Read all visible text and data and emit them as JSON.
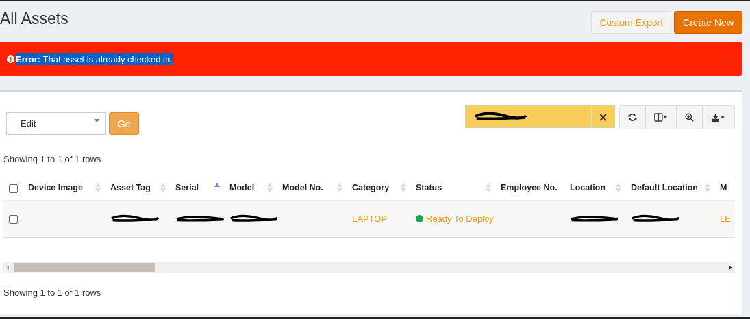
{
  "page_title": "All Assets",
  "header_buttons": [
    {
      "label": "Custom Export",
      "kind": "secondary"
    },
    {
      "label": "Create New",
      "kind": "primary"
    }
  ],
  "alert": {
    "prefix": "Error:",
    "message": "That asset is already checked in.",
    "selected": true
  },
  "bulk_action": {
    "value": "Edit",
    "button": "Go"
  },
  "search": {
    "redacted": true,
    "clear": "×"
  },
  "summary_top": "Showing 1 to 1 of 1 rows",
  "table": {
    "all_checked": false,
    "columns": [
      {
        "label": "Device Image",
        "sortable": true,
        "sorted": false
      },
      {
        "label": "Asset Tag",
        "sortable": true,
        "sorted": false
      },
      {
        "label": "Serial",
        "sortable": true,
        "sorted": true
      },
      {
        "label": "Model",
        "sortable": true,
        "sorted": false
      },
      {
        "label": "Model No.",
        "sortable": true,
        "sorted": false
      },
      {
        "label": "Category",
        "sortable": true,
        "sorted": false
      },
      {
        "label": "Status",
        "sortable": true,
        "sorted": false
      },
      {
        "label": "Employee No.",
        "sortable": false,
        "sorted": false
      },
      {
        "label": "Location",
        "sortable": true,
        "sorted": false
      },
      {
        "label": "Default Location",
        "sortable": true,
        "sorted": false
      },
      {
        "label": "M",
        "sortable": false,
        "sorted": false
      }
    ],
    "rows": [
      {
        "checked": false,
        "cells": [
          {
            "kind": "empty"
          },
          {
            "kind": "redacted"
          },
          {
            "kind": "redacted"
          },
          {
            "kind": "redacted"
          },
          {
            "kind": "empty"
          },
          {
            "kind": "link",
            "text": "LAPTOP"
          },
          {
            "kind": "status",
            "text": "Ready To Deploy",
            "color": "#18a55c"
          },
          {
            "kind": "empty"
          },
          {
            "kind": "redacted"
          },
          {
            "kind": "redacted"
          },
          {
            "kind": "link",
            "text": "LE"
          }
        ]
      }
    ]
  },
  "summary_bottom": "Showing 1 to 1 of 1 rows"
}
